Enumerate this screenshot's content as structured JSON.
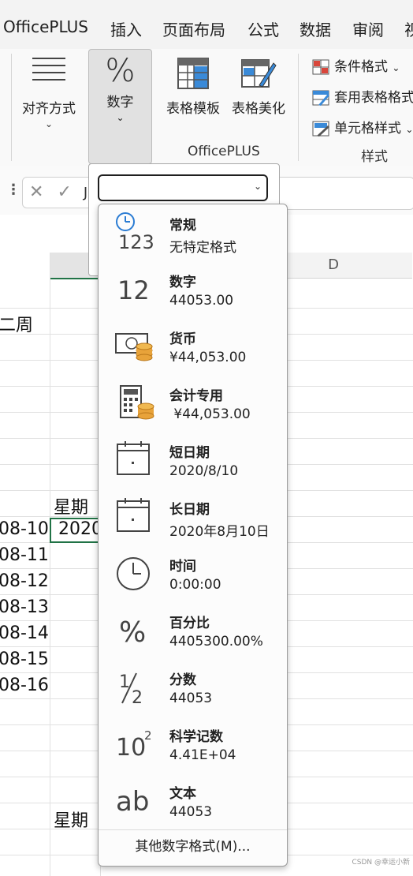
{
  "menubar": {
    "tabs": [
      "OfficePLUS",
      "插入",
      "页面布局",
      "公式",
      "数据",
      "审阅",
      "视"
    ]
  },
  "ribbon": {
    "align_label": "对齐方式",
    "number_label": "数字",
    "number_symbol": "%",
    "template_label": "表格模板",
    "beautify_label": "表格美化",
    "officeplus_group": "OfficePLUS",
    "cond_format": "条件格式",
    "apply_table_format": "套用表格格式",
    "cell_style": "单元格样式",
    "styles_group": "样式"
  },
  "formula_bar": {
    "cancel": "✕",
    "confirm": "✓",
    "fx_partial": "J"
  },
  "grid": {
    "col_d": "D",
    "cells": {
      "week2": "二周",
      "weekday1": "星期",
      "weekday2": "星期",
      "active_value": "2020",
      "dates": [
        "08-10",
        "08-11",
        "08-12",
        "08-13",
        "08-14",
        "08-15",
        "08-16"
      ]
    }
  },
  "format_combo": {
    "value": ""
  },
  "formats": [
    {
      "name": "常规",
      "sample": "无特定格式",
      "icon": "general-clock-123-icon"
    },
    {
      "name": "数字",
      "sample": "44053.00",
      "icon": "number-12-icon"
    },
    {
      "name": "货币",
      "sample": "¥44,053.00",
      "icon": "currency-coins-icon"
    },
    {
      "name": "会计专用",
      "sample": " ¥44,053.00",
      "icon": "accounting-calculator-icon"
    },
    {
      "name": "短日期",
      "sample": "2020/8/10",
      "icon": "short-date-calendar-icon"
    },
    {
      "name": "长日期",
      "sample": "2020年8月10日",
      "icon": "long-date-calendar-icon"
    },
    {
      "name": "时间",
      "sample": "0:00:00",
      "icon": "time-clock-icon"
    },
    {
      "name": "百分比",
      "sample": "4405300.00%",
      "icon": "percent-icon"
    },
    {
      "name": "分数",
      "sample": "44053",
      "icon": "fraction-icon"
    },
    {
      "name": "科学记数",
      "sample": "4.41E+04",
      "icon": "scientific-10-squared-icon"
    },
    {
      "name": "文本",
      "sample": "44053",
      "icon": "text-ab-icon"
    }
  ],
  "more_formats": "其他数字格式(M)...",
  "icon_text": {
    "general_digits": "123",
    "number_digits": "12",
    "percent": "%",
    "fraction_num": "1",
    "fraction_den": "2",
    "sci_base": "10",
    "sci_exp": "2",
    "text_ab": "ab"
  },
  "watermark": "CSDN @幸运小新",
  "colors": {
    "active_cell_border": "#217346",
    "coin": "#e8a33a",
    "grid_line": "#e1e1e1"
  }
}
